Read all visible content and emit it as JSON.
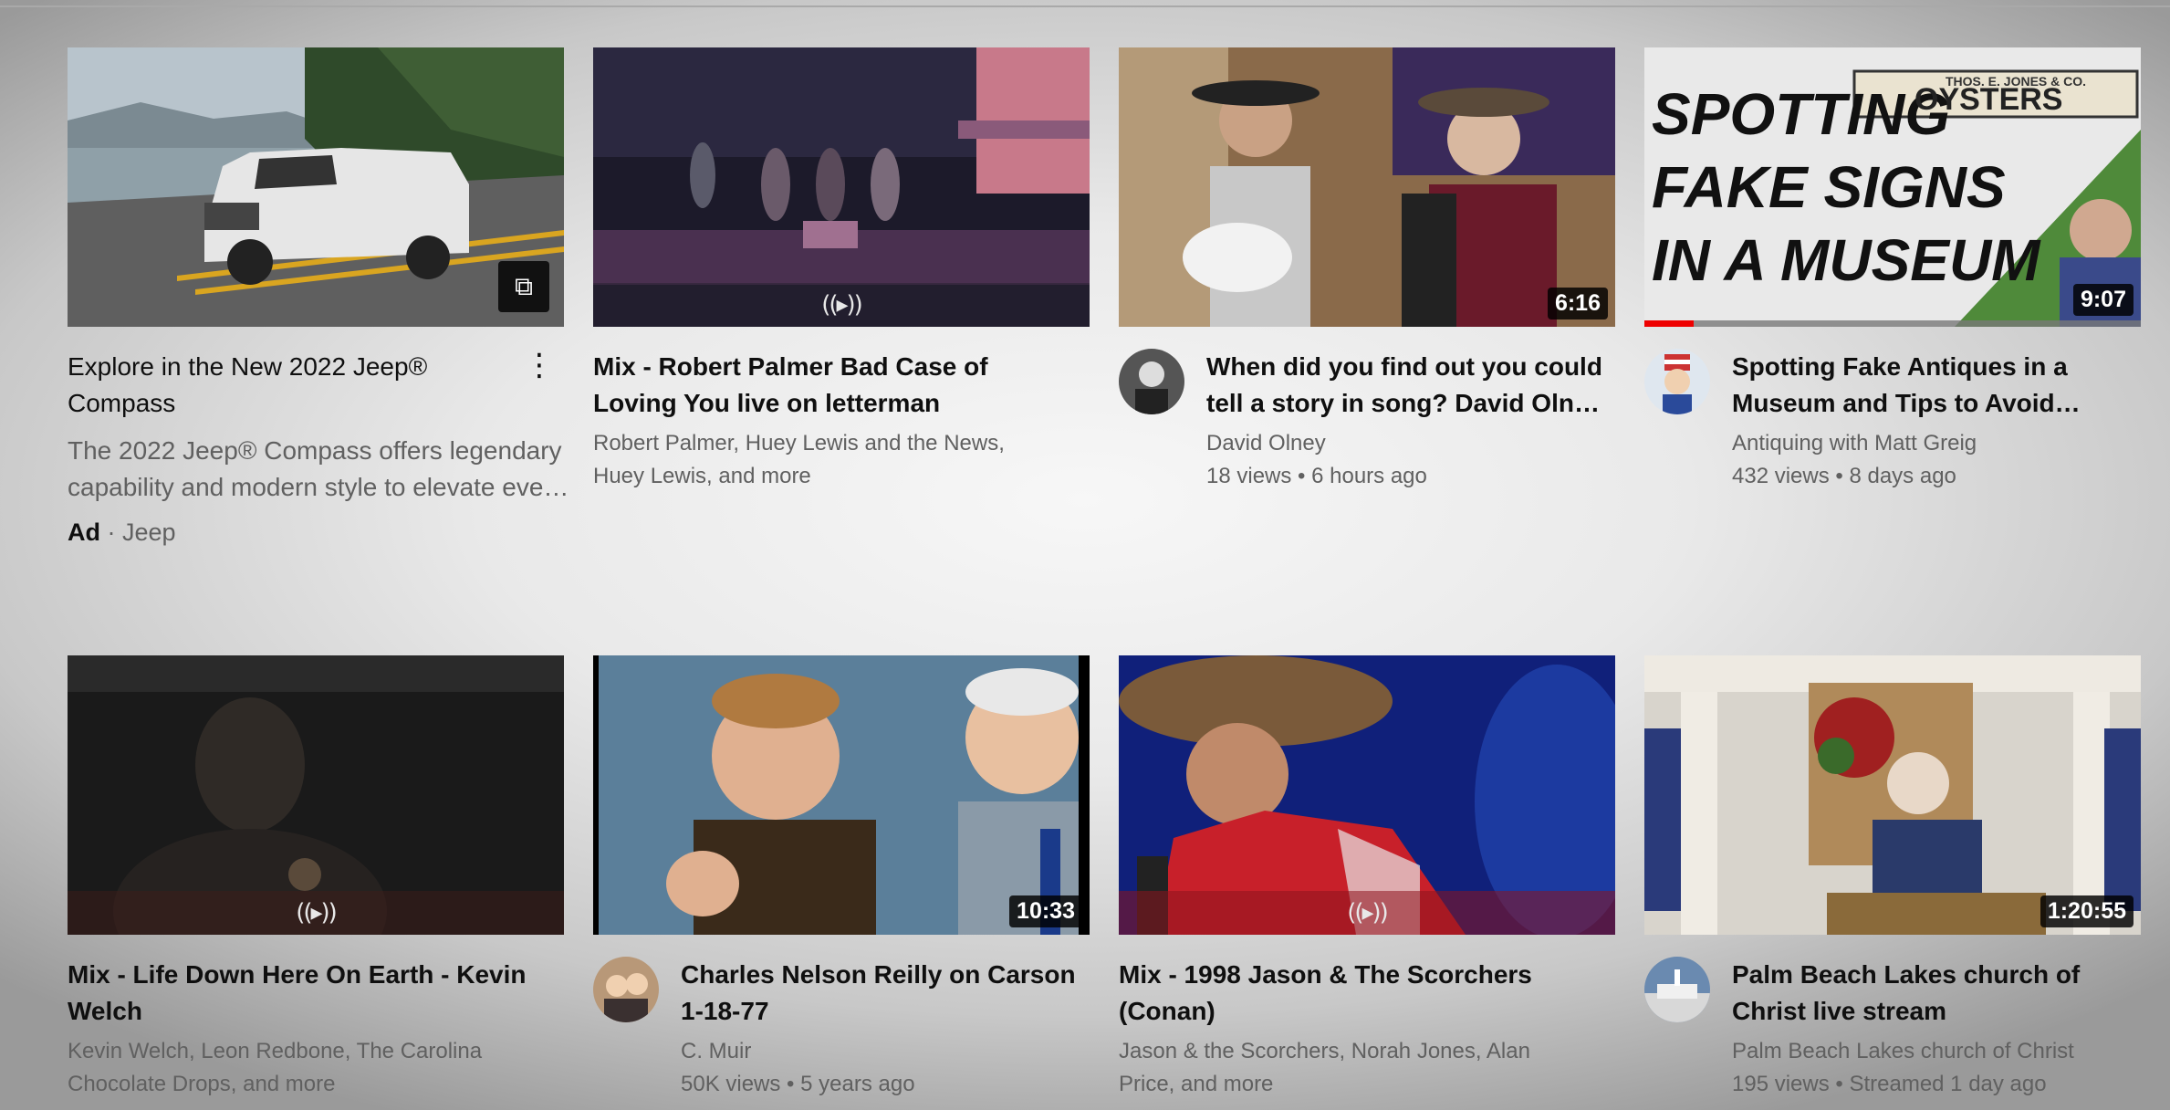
{
  "videos": [
    {
      "title_l1": "Explore in the New 2022 Jeep®",
      "title_l2": "Compass",
      "desc_l1": "The 2022 Jeep® Compass offers legendary",
      "desc_l2": "capability and modern style to elevate eve…",
      "ad_label": "Ad",
      "ad_sep": " · ",
      "advertiser": "Jeep"
    },
    {
      "title_l1": "Mix - Robert Palmer Bad Case of",
      "title_l2": "Loving You live on letterman",
      "sub_l1": "Robert Palmer, Huey Lewis and the News,",
      "sub_l2": "Huey Lewis, and more",
      "mix_icon": "((▸))"
    },
    {
      "title_l1": "When did you find out you could",
      "title_l2": "tell a story in song? David Oln…",
      "channel": "David Olney",
      "stats": "18 views • 6 hours ago",
      "duration": "6:16"
    },
    {
      "title_l1": "Spotting Fake Antiques in a",
      "title_l2": "Museum and Tips to Avoid…",
      "channel": "Antiquing with Matt Greig",
      "stats": "432 views • 8 days ago",
      "duration": "9:07",
      "watched_fraction": 0.1,
      "thumb_text_l1": "SPOTTING",
      "thumb_text_l2": "FAKE SIGNS",
      "thumb_text_l3": "IN A MUSEUM",
      "thumb_sign_small": "THOS. E. JONES & CO.",
      "thumb_sign_big": "OYSTERS"
    },
    {
      "title_l1": "Mix - Life Down Here On Earth - Kevin",
      "title_l2": "Welch",
      "sub_l1": "Kevin Welch, Leon Redbone, The Carolina",
      "sub_l2": "Chocolate Drops, and more",
      "mix_icon": "((▸))"
    },
    {
      "title_l1": "Charles Nelson Reilly on Carson",
      "title_l2": "1-18-77",
      "channel": "C. Muir",
      "stats": "50K views • 5 years ago",
      "duration": "10:33"
    },
    {
      "title_l1": "Mix - 1998 Jason & The Scorchers",
      "title_l2": "(Conan)",
      "sub_l1": "Jason & the Scorchers, Norah Jones, Alan",
      "sub_l2": "Price, and more",
      "mix_icon": "((▸))"
    },
    {
      "title_l1": "Palm Beach Lakes church of",
      "title_l2": "Christ live stream",
      "channel": "Palm Beach Lakes church of Christ",
      "stats": "195 views • Streamed 1 day ago",
      "duration": "1:20:55"
    }
  ]
}
